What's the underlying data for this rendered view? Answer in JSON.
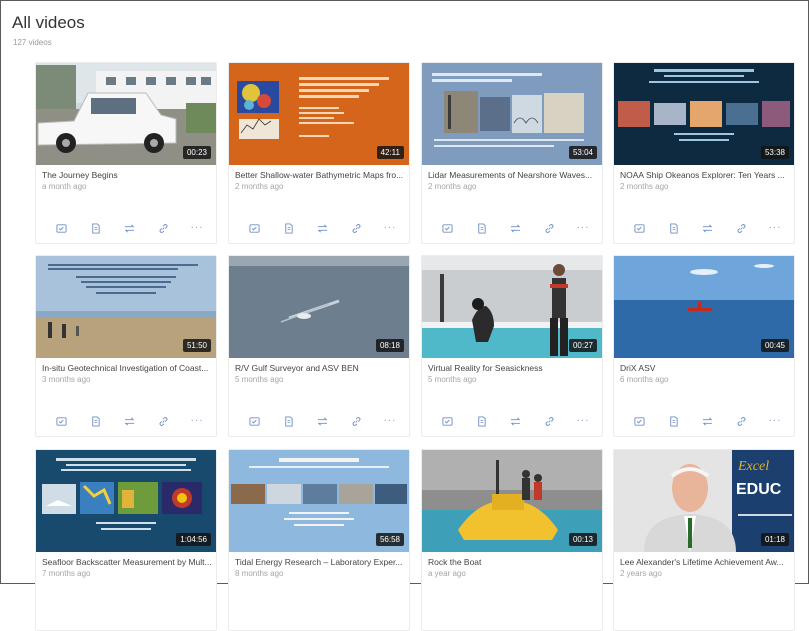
{
  "header": {
    "title": "All videos",
    "count": "127 videos"
  },
  "colors": {
    "action_icon": "#6f8fc0",
    "duration_bg": "#141414",
    "meta_text": "#a5a5a5"
  },
  "card_actions": [
    "captions-icon",
    "document-icon",
    "swap-icon",
    "link-icon",
    "more-icon"
  ],
  "videos": [
    {
      "title": "The Journey Begins",
      "age": "a month ago",
      "duration": "00:23"
    },
    {
      "title": "Better Shallow-water Bathymetric Maps fro...",
      "age": "2 months ago",
      "duration": "42:11"
    },
    {
      "title": "Lidar Measurements of Nearshore Waves...",
      "age": "2 months ago",
      "duration": "53:04"
    },
    {
      "title": "NOAA Ship Okeanos Explorer: Ten Years ...",
      "age": "2 months ago",
      "duration": "53:38"
    },
    {
      "title": "In-situ Geotechnical Investigation of Coast...",
      "age": "3 months ago",
      "duration": "51:50"
    },
    {
      "title": "R/V Gulf Surveyor and ASV BEN",
      "age": "5 months ago",
      "duration": "08:18"
    },
    {
      "title": "Virtual Reality for Seasickness",
      "age": "5 months ago",
      "duration": "00:27"
    },
    {
      "title": "DriX ASV",
      "age": "6 months ago",
      "duration": "00:45"
    },
    {
      "title": "Seafloor Backscatter Measurement by Mult...",
      "age": "7 months ago",
      "duration": "1:04:56"
    },
    {
      "title": "Tidal Energy Research – Laboratory Exper...",
      "age": "8 months ago",
      "duration": "56:58"
    },
    {
      "title": "Rock the Boat",
      "age": "a year ago",
      "duration": "00:13"
    },
    {
      "title": "Lee Alexander's Lifetime Achievement Aw...",
      "age": "2 years ago",
      "duration": "01:18"
    }
  ]
}
